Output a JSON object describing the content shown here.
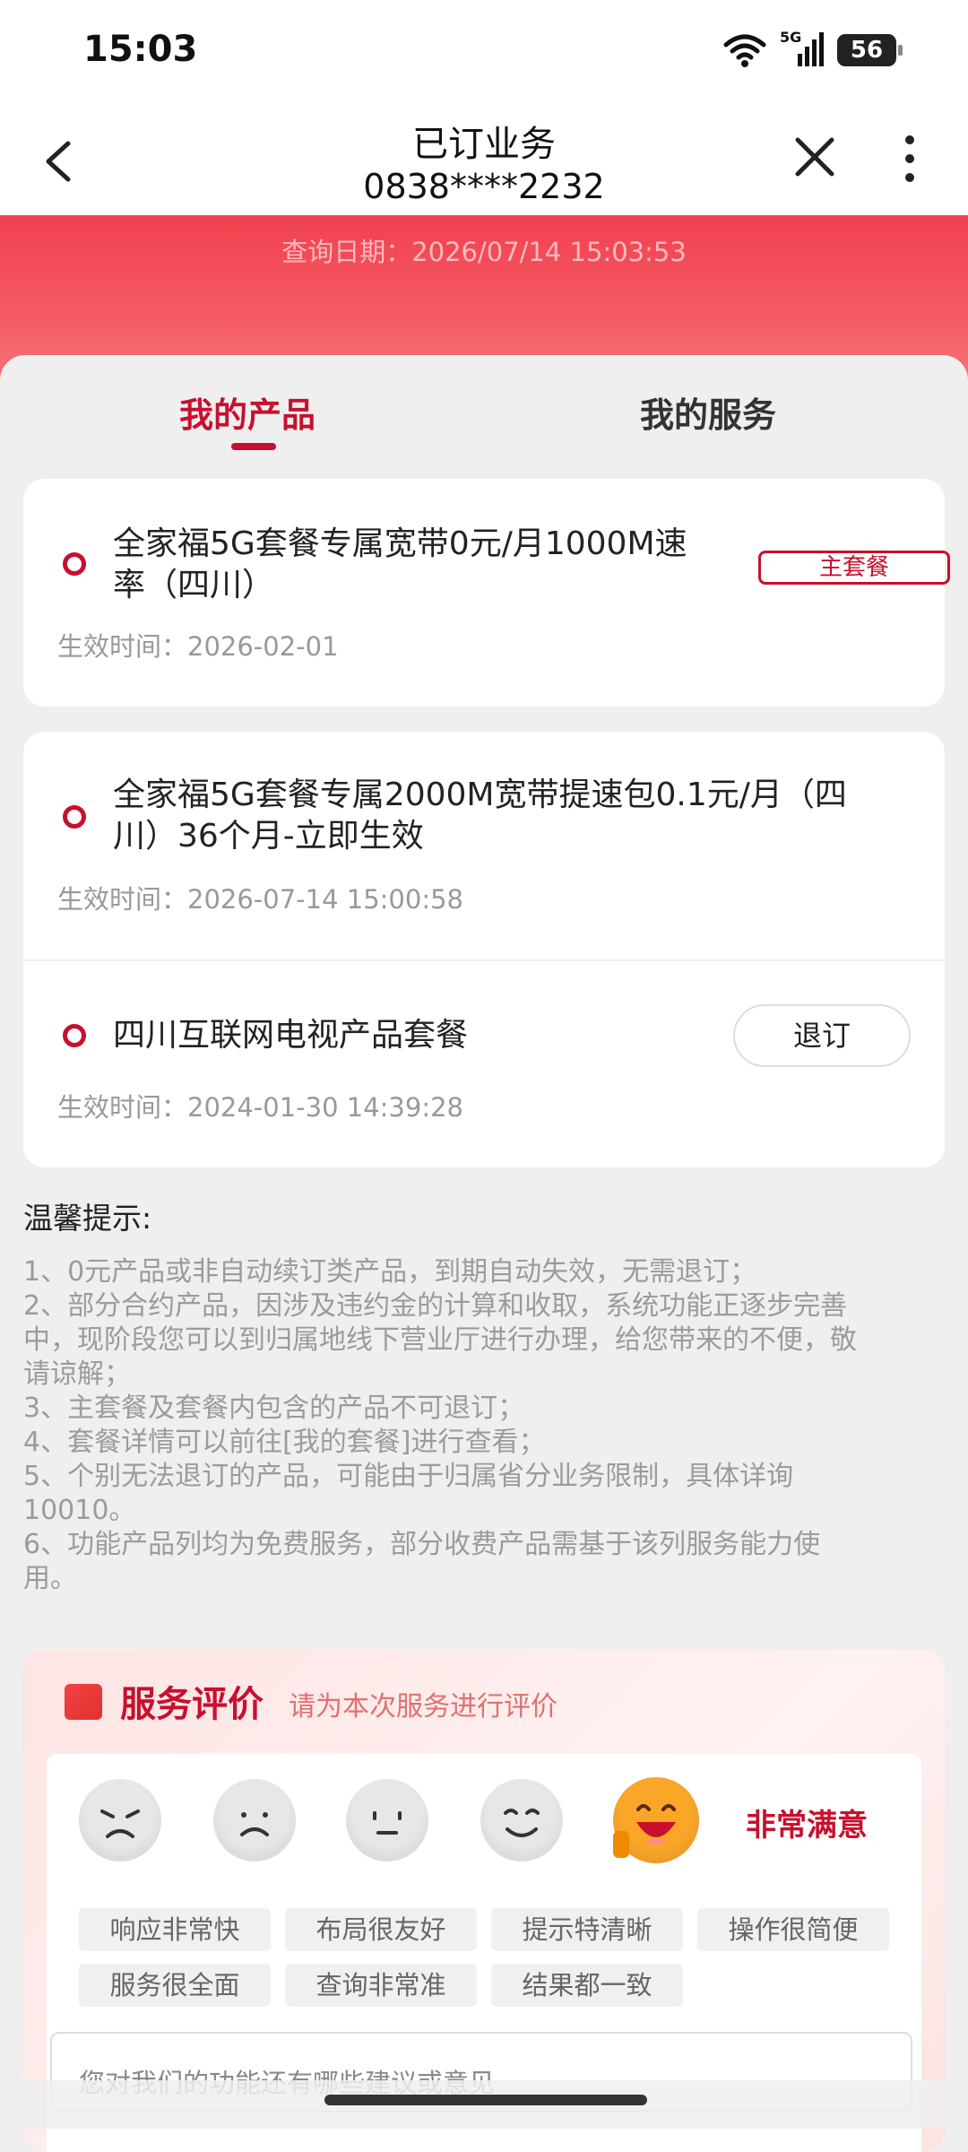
{
  "status_bar": {
    "time": "15:03",
    "battery": "56",
    "network": "5G"
  },
  "header": {
    "title": "已订业务",
    "phone": "0838****2232"
  },
  "banner": {
    "query_date": "查询日期：2026/07/14 15:03:53",
    "color": "#f0414f"
  },
  "tabs": [
    {
      "label": "我的产品",
      "active": true
    },
    {
      "label": "我的服务",
      "active": false
    }
  ],
  "products": [
    {
      "title_line1": "全家福5G套餐专属宽带0元/月1000M速",
      "title_line2": "率（四川）",
      "badge": "主套餐",
      "effective": "生效时间：2026-02-01"
    },
    {
      "title_line1": "全家福5G套餐专属2000M宽带提速包0.1元/月（四",
      "title_line2": "川）36个月-立即生效",
      "effective": "生效时间：2026-07-14 15:00:58"
    },
    {
      "title_line1": "四川互联网电视产品套餐",
      "button": "退订",
      "effective": "生效时间：2024-01-30 14:39:28"
    }
  ],
  "tips": {
    "title": "温馨提示:",
    "lines": [
      "1、0元产品或非自动续订类产品，到期自动失效，无需退订；",
      "2、部分合约产品，因涉及违约金的计算和收取，系统功能正逐步完善",
      "中，现阶段您可以到归属地线下营业厅进行办理，给您带来的不便，敬",
      "请谅解；",
      "3、主套餐及套餐内包含的产品不可退订；",
      "4、套餐详情可以前往[我的套餐]进行查看；",
      "5、个别无法退订的产品，可能由于归属省分业务限制，具体详询",
      "10010。",
      "6、功能产品列均为免费服务，部分收费产品需基于该列服务能力使",
      "用。"
    ]
  },
  "evaluation": {
    "title": "服务评价",
    "subtitle": "请为本次服务进行评价",
    "rating_label": "非常满意",
    "tags": [
      "响应非常快",
      "布局很友好",
      "提示特清晰",
      "操作很简便",
      "服务很全面",
      "查询非常准",
      "结果都一致"
    ],
    "suggestion_placeholder": "您对我们的功能还有哪些建议或意见"
  },
  "accent_color": "#c8102e"
}
